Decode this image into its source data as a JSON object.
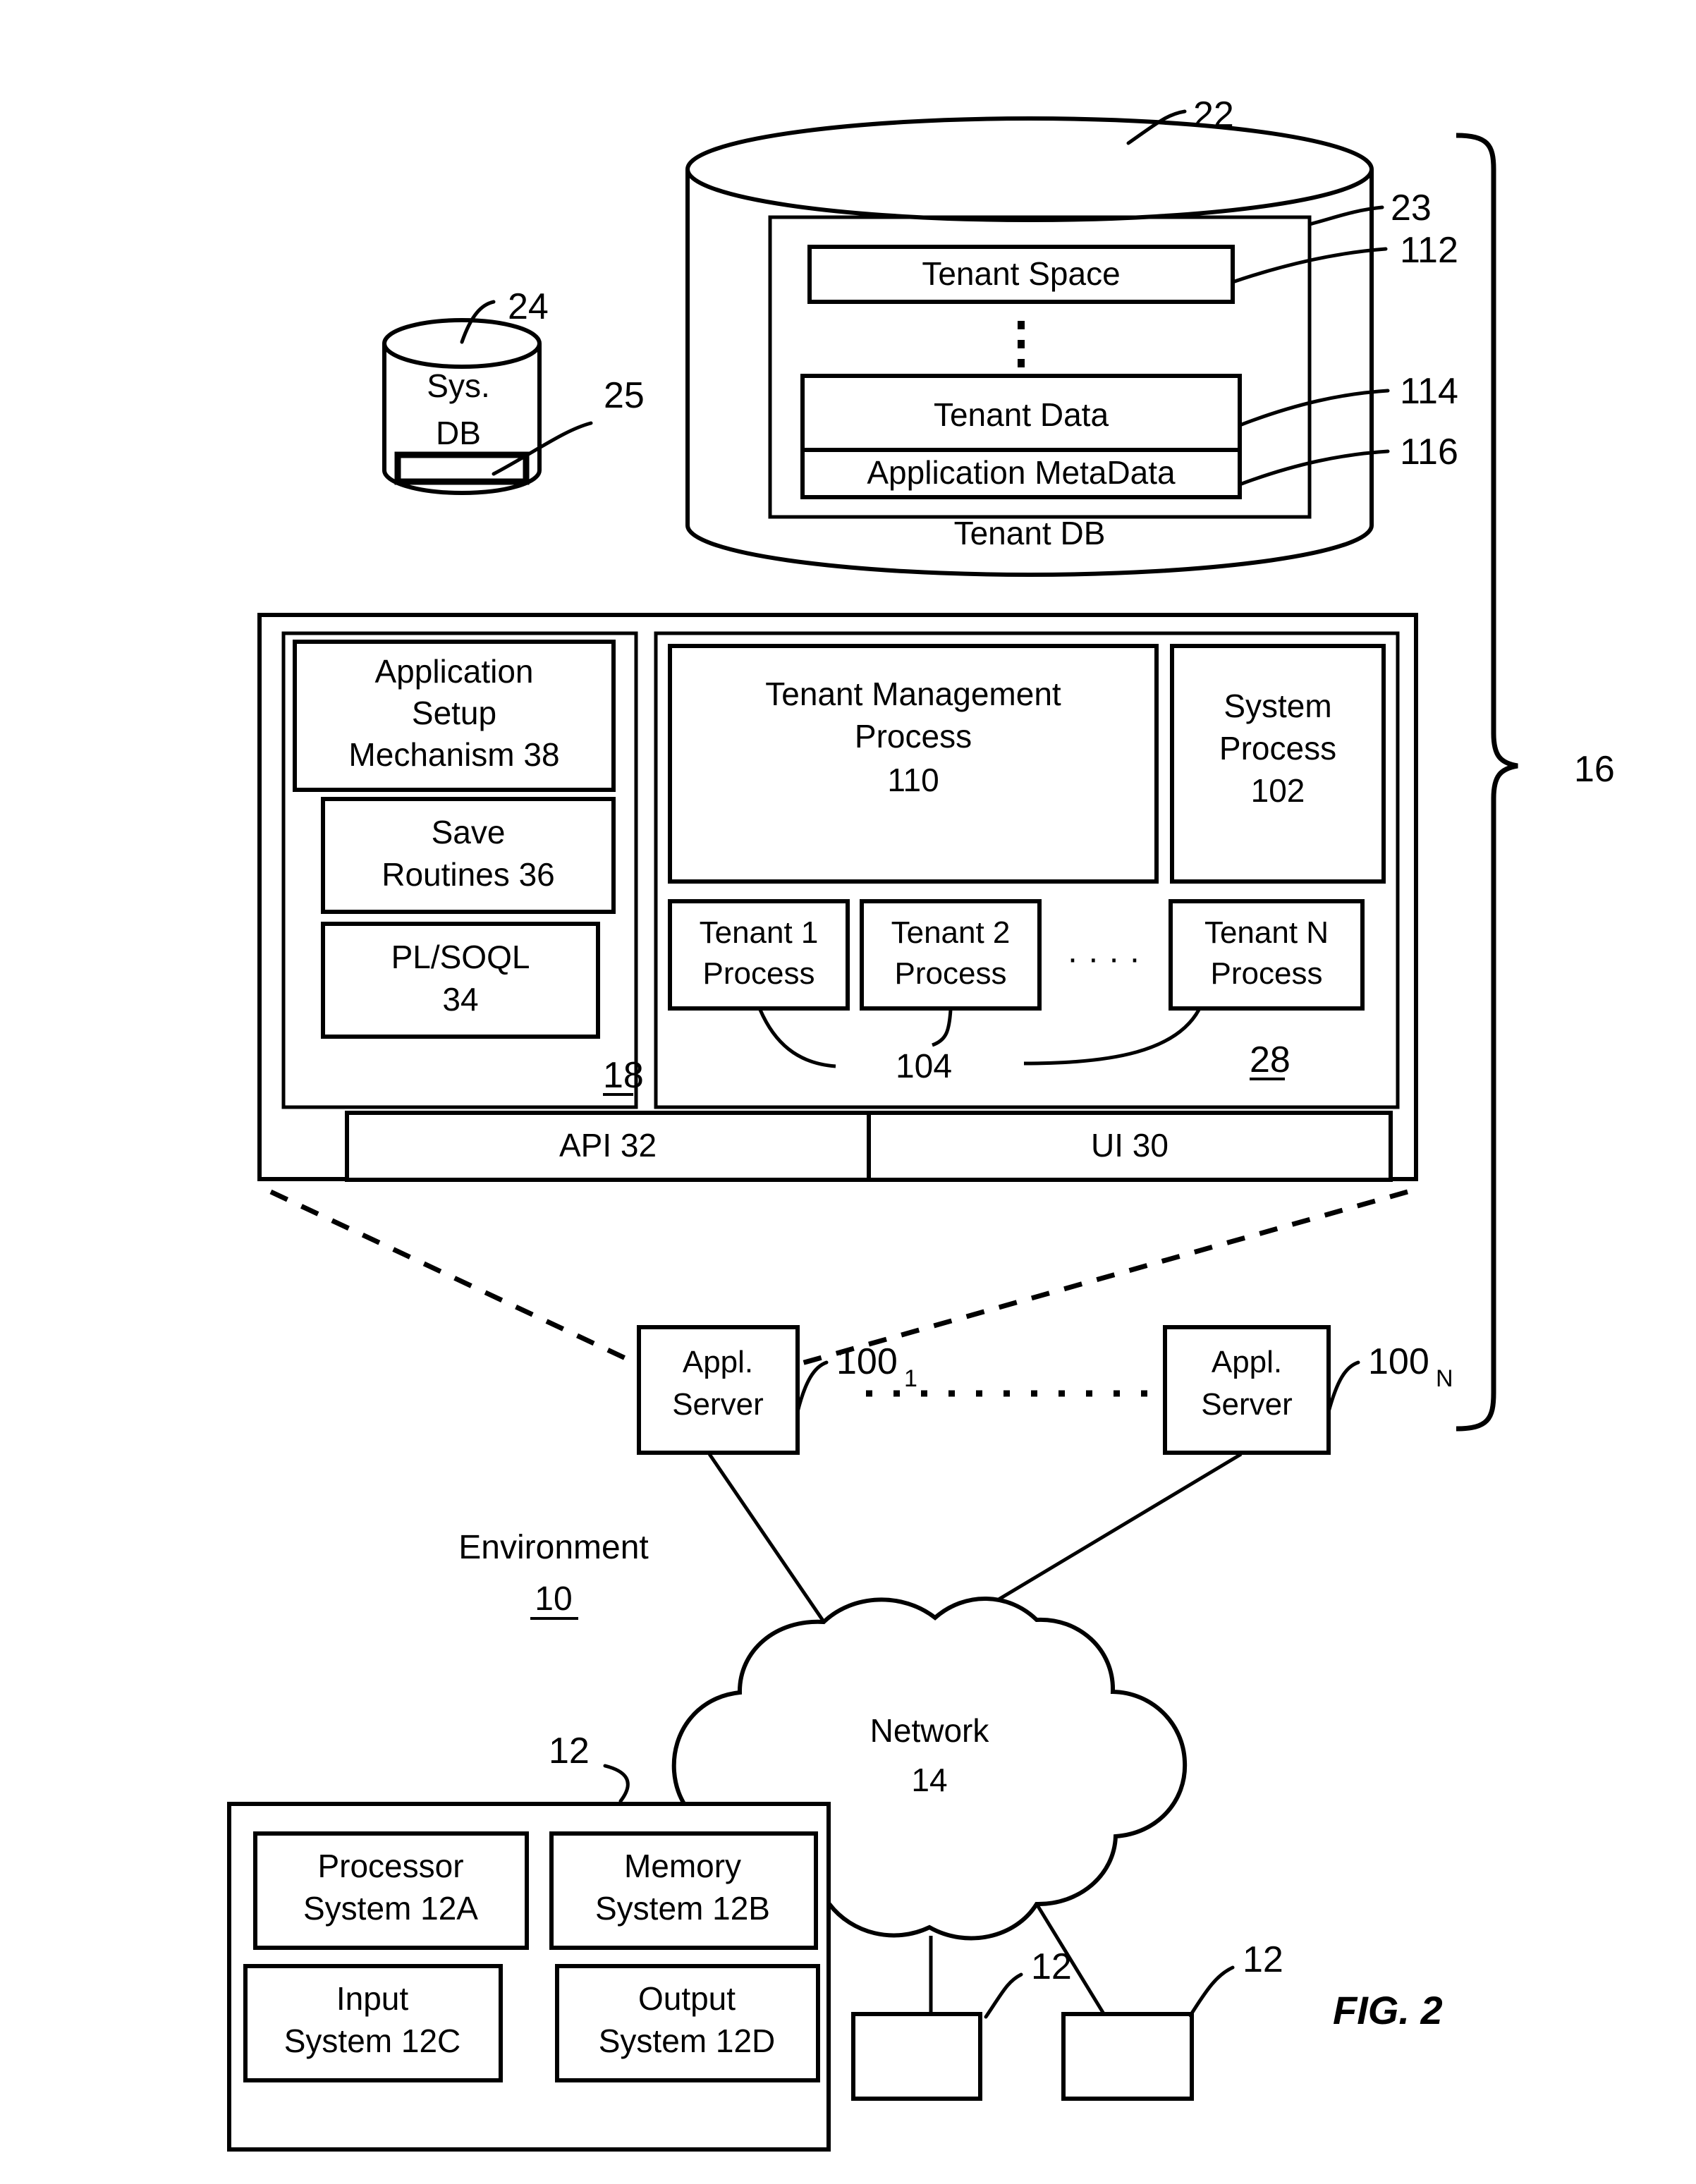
{
  "figure": {
    "caption": "FIG. 2"
  },
  "tenant_db": {
    "cylinder_label": "Tenant DB",
    "ref_cylinder": "22",
    "ref_inner_container": "23",
    "items": [
      {
        "label": "Tenant Space",
        "ref": "112"
      },
      {
        "label": "Tenant Data",
        "ref": "114"
      },
      {
        "label": "Application MetaData",
        "ref": "116"
      }
    ],
    "ellipsis": "⋮"
  },
  "sys_db": {
    "line1": "Sys.",
    "line2": "DB",
    "ref_cylinder": "24",
    "ref_index": "25"
  },
  "platform": {
    "ref_bracket": "16",
    "setup_section": {
      "ref": "18",
      "boxes": [
        {
          "line1": "Application",
          "line2": "Setup",
          "line3": "Mechanism 38"
        },
        {
          "line1": "Save",
          "line2": "Routines 36"
        },
        {
          "line1": "PL/SOQL",
          "line2": "34"
        }
      ]
    },
    "process_section": {
      "ref": "28",
      "tenant_management": {
        "line1": "Tenant Management",
        "line2": "Process",
        "line3": "110"
      },
      "system_process": {
        "line1": "System",
        "line2": "Process",
        "line3": "102"
      },
      "tenant_processes": [
        {
          "line1": "Tenant 1",
          "line2": "Process"
        },
        {
          "line1": "Tenant 2",
          "line2": "Process"
        },
        {
          "line1": "Tenant N",
          "line2": "Process"
        }
      ],
      "tenant_process_ref": "104",
      "tenant_process_ellipsis": "· · · ·"
    },
    "api_label": "API 32",
    "ui_label": "UI 30"
  },
  "app_servers": [
    {
      "line1": "Appl.",
      "line2": "Server",
      "ref_base": "100",
      "ref_sub": "1"
    },
    {
      "line1": "Appl.",
      "line2": "Server",
      "ref_base": "100",
      "ref_sub": "N"
    }
  ],
  "environment": {
    "label": "Environment",
    "ref": "10"
  },
  "network": {
    "line1": "Network",
    "line2": "14"
  },
  "user_system": {
    "ref": "12",
    "boxes": [
      {
        "line1": "Processor",
        "line2": "System 12A"
      },
      {
        "line1": "Memory",
        "line2": "System 12B"
      },
      {
        "line1": "Input",
        "line2": "System 12C"
      },
      {
        "line1": "Output",
        "line2": "System 12D"
      }
    ]
  },
  "user_terminals": [
    {
      "ref": "12"
    },
    {
      "ref": "12"
    }
  ]
}
